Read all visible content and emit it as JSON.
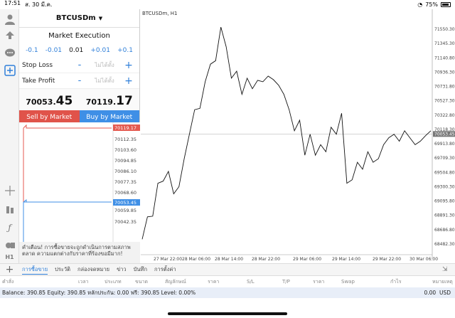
{
  "status": {
    "time": "17:51",
    "date": "ส. 30 มี.ค.",
    "battery": "75%"
  },
  "panel": {
    "symbol": "BTCUSDm",
    "execution": "Market Execution",
    "lots": [
      "-0.1",
      "-0.01",
      "0.01",
      "+0.01",
      "+0.1"
    ],
    "stop_loss": {
      "label": "Stop Loss",
      "value": "ไม่ได้ตั้ง"
    },
    "take_profit": {
      "label": "Take Profit",
      "value": "ไม่ได้ตั้ง"
    },
    "sell_price_main": "70053.",
    "sell_price_big": "45",
    "buy_price_main": "70119.",
    "buy_price_big": "17",
    "sell_label": "Sell by Market",
    "buy_label": "Buy by Market",
    "mini_prices": [
      "70119.17",
      "70112.35",
      "70103.60",
      "70094.85",
      "70086.10",
      "70077.35",
      "70068.60",
      "70059.85",
      "70053.45",
      "70042.35"
    ],
    "warning": "คำเตือน! การซื้อขายจะถูกดำเนินการตามสภาพตลาด ความแตกต่างกับราคาที่ร้องขอมีมาก!"
  },
  "chart": {
    "label": "BTCUSDm, H1",
    "price_labels": [
      "71550.30",
      "71345.30",
      "71140.80",
      "70936.30",
      "70731.80",
      "70527.30",
      "70322.80",
      "70118.30",
      "70053.45",
      "69913.80",
      "69709.30",
      "69504.80",
      "69300.30",
      "69095.80",
      "68891.30",
      "68686.80",
      "68482.30"
    ],
    "time_labels": [
      "27 Mar 22:00",
      "28 Mar 06:00",
      "28 Mar 14:00",
      "28 Mar 22:00",
      "29 Mar 06:00",
      "29 Mar 14:00",
      "29 Mar 22:00",
      "30 Mar 06:00"
    ],
    "current_price": "70053.45"
  },
  "chart_data": {
    "type": "line",
    "title": "BTCUSDm, H1",
    "series": [
      {
        "name": "BTCUSDm",
        "values": [
          68550,
          68870,
          68880,
          69350,
          69380,
          69520,
          69200,
          69300,
          69700,
          70050,
          70400,
          70420,
          70800,
          71050,
          71100,
          71580,
          71300,
          70850,
          70950,
          70620,
          70850,
          70700,
          70820,
          70800,
          70880,
          70830,
          70750,
          70620,
          70400,
          70100,
          70250,
          69750,
          70050,
          69750,
          69900,
          69800,
          70150,
          70050,
          70350,
          69350,
          69400,
          69650,
          69550,
          69800,
          69650,
          69700,
          69900,
          70000,
          70050,
          69950,
          70100,
          70000,
          69900,
          69950,
          70030,
          70100
        ]
      }
    ],
    "ylim": [
      68482.3,
      71550.3
    ]
  },
  "bottom": {
    "tabs": [
      "การซื้อขาย",
      "ประวัติ",
      "กล่องจดหมาย",
      "ข่าว",
      "บันทึก",
      "การตั้งค่า"
    ],
    "active_tab": "การซื้อขาย",
    "columns": [
      "คำสั่ง",
      "เวลา",
      "ประเภท",
      "ขนาด",
      "สัญลักษณ์",
      "ราคา",
      "S/L",
      "T/P",
      "ราคา",
      "Swap",
      "กำไร",
      "หมายเหตุ"
    ],
    "balance_text": "Balance: 390.85 Equity: 390.85 หลักประกัน: 0.00 ฟรี: 390.85 Level: 0.00%",
    "profit_total": "0.00",
    "currency": "USD"
  }
}
